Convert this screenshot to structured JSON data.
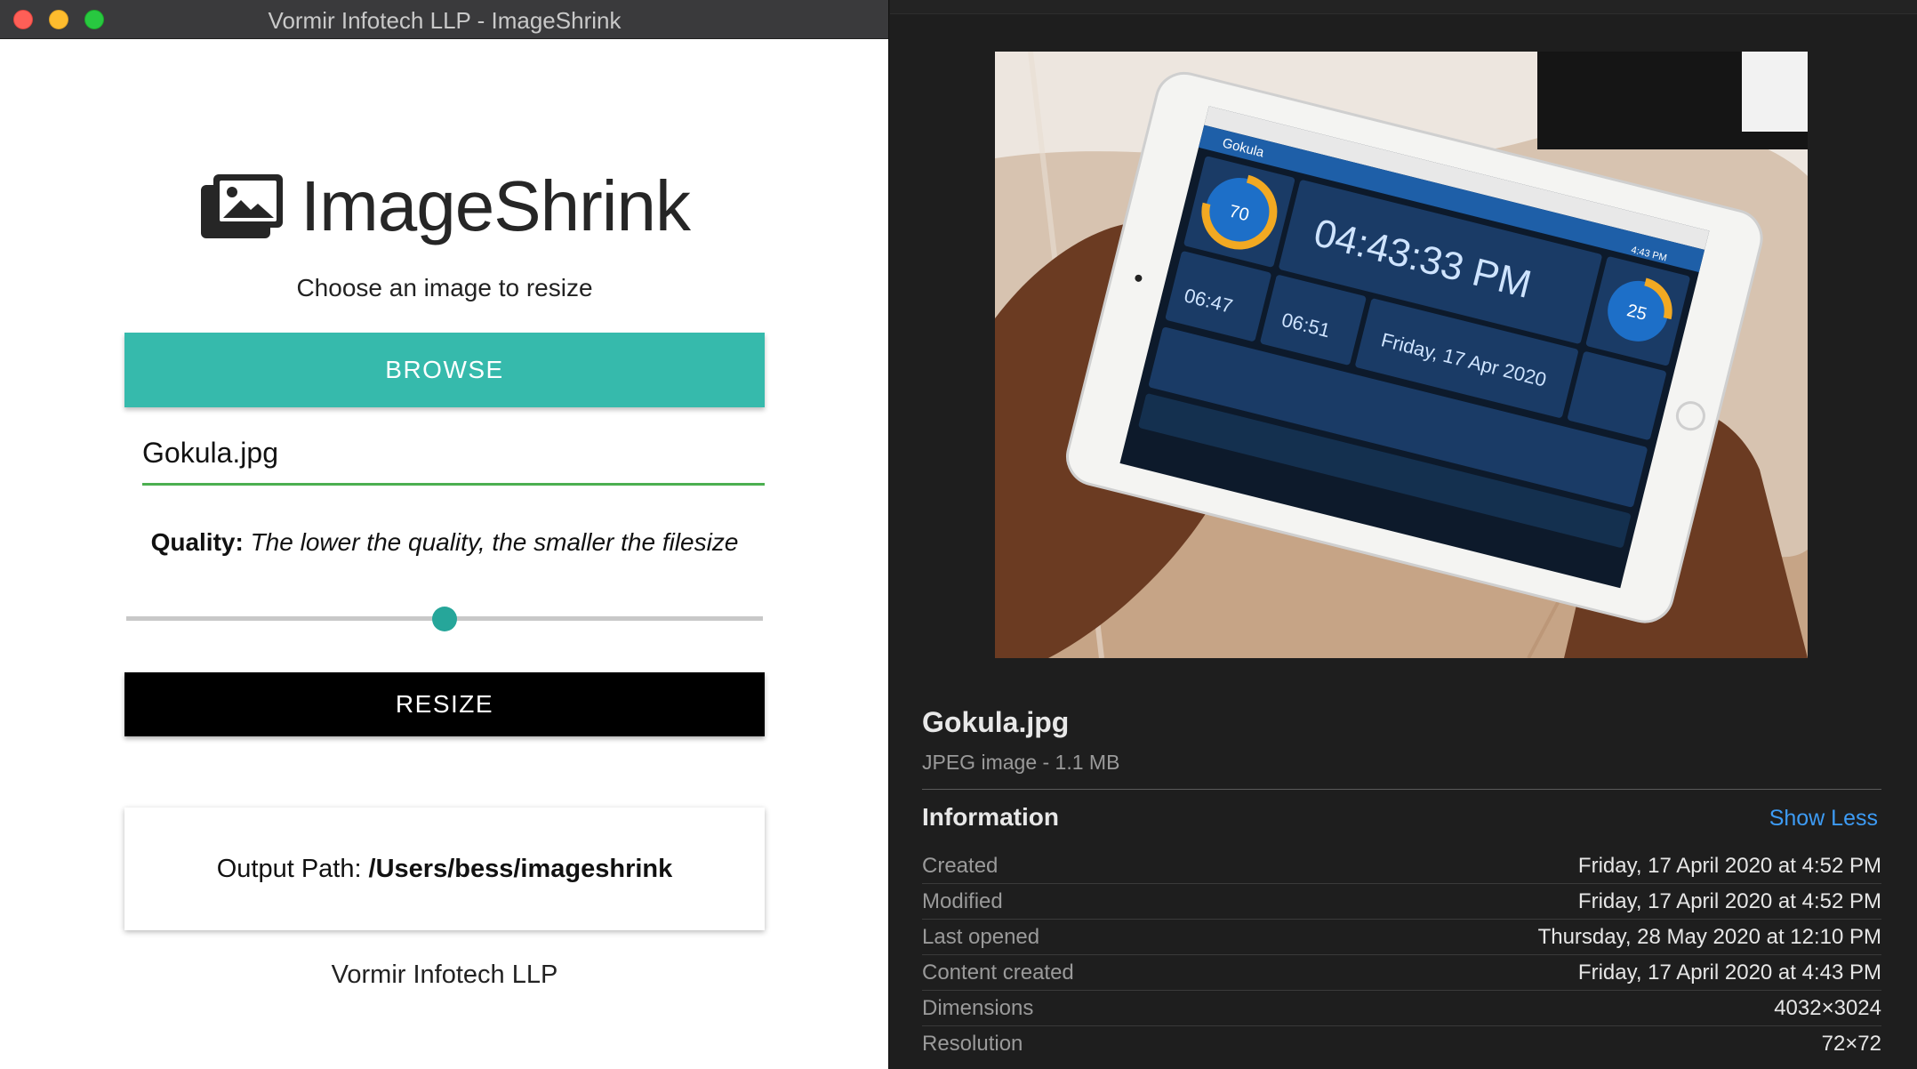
{
  "window": {
    "title": "Vormir Infotech LLP - ImageShrink"
  },
  "app": {
    "logo_text": "ImageShrink",
    "subtitle": "Choose an image to resize",
    "browse_label": "BROWSE",
    "file_input_value": "Gokula.jpg",
    "quality_label": "Quality:",
    "quality_hint": "The lower the quality, the smaller the filesize",
    "quality_value": 50,
    "quality_min": 0,
    "quality_max": 100,
    "resize_label": "RESIZE",
    "output_label": "Output Path:",
    "output_path": "/Users/bess/imageshrink",
    "footer": "Vormir Infotech LLP"
  },
  "preview_tablet": {
    "time": "04:43:33 PM",
    "date": "Friday, 17 Apr 2020",
    "sunrise": "06:47",
    "sunset": "06:51",
    "gauge_left": "70",
    "gauge_right": "25",
    "app_name": "Gokula",
    "status_time": "4:43 PM"
  },
  "info": {
    "file_name": "Gokula.jpg",
    "file_kind": "JPEG image - 1.1 MB",
    "section_title": "Information",
    "show_less_label": "Show Less",
    "rows": [
      {
        "key": "Created",
        "value": "Friday, 17 April 2020 at 4:52 PM"
      },
      {
        "key": "Modified",
        "value": "Friday, 17 April 2020 at 4:52 PM"
      },
      {
        "key": "Last opened",
        "value": "Thursday, 28 May 2020 at 12:10 PM"
      },
      {
        "key": "Content created",
        "value": "Friday, 17 April 2020 at 4:43 PM"
      },
      {
        "key": "Dimensions",
        "value": "4032×3024"
      },
      {
        "key": "Resolution",
        "value": "72×72"
      }
    ]
  },
  "colors": {
    "browse_bg": "#36baac",
    "input_underline": "#4caf50",
    "slider_thumb": "#26a69a",
    "link": "#3d9bf4"
  },
  "icons": {
    "logo": "images-icon"
  }
}
